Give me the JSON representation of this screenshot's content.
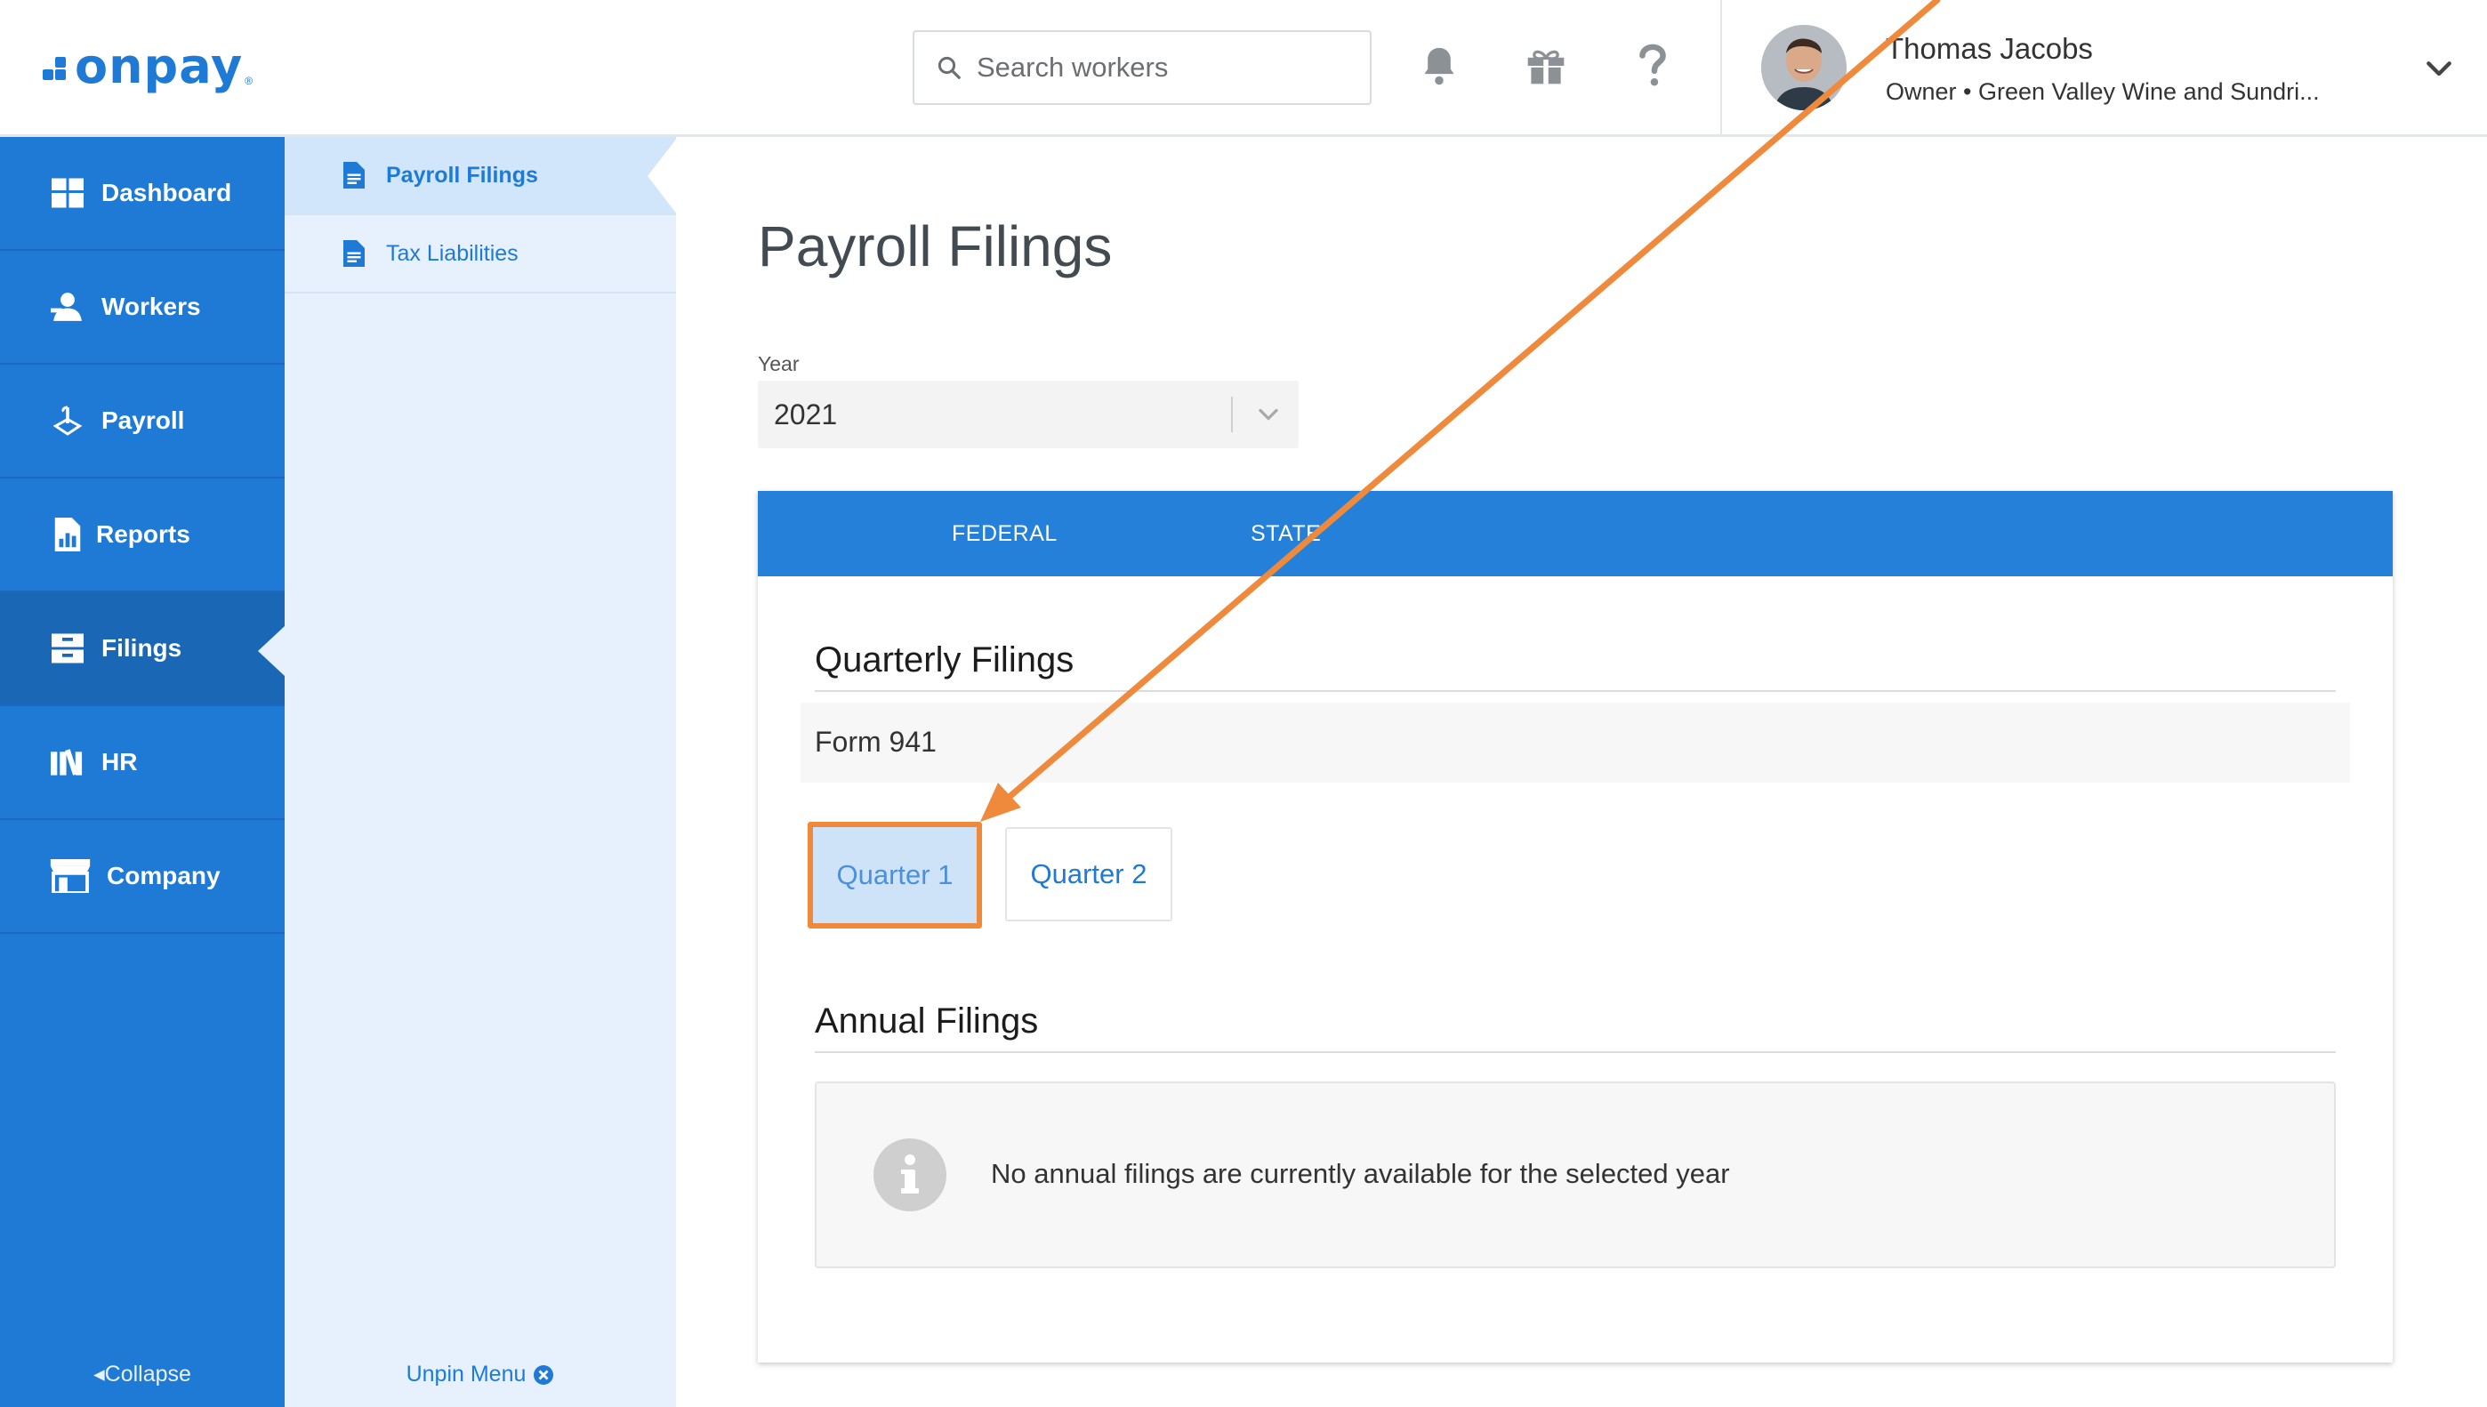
{
  "brand": {
    "logo_text": "onpay",
    "logo_mark": "®",
    "accent": "#1f7ad6"
  },
  "header": {
    "search": {
      "placeholder": "Search workers"
    },
    "icons": [
      "bell-icon",
      "gift-icon",
      "help-icon"
    ],
    "user": {
      "name": "Thomas Jacobs",
      "subtitle": "Owner • Green Valley Wine and Sundri..."
    }
  },
  "nav": {
    "items": [
      {
        "label": "Dashboard",
        "icon": "dashboard-icon"
      },
      {
        "label": "Workers",
        "icon": "workers-icon"
      },
      {
        "label": "Payroll",
        "icon": "payroll-icon"
      },
      {
        "label": "Reports",
        "icon": "reports-icon"
      },
      {
        "label": "Filings",
        "icon": "filings-icon",
        "active": true
      },
      {
        "label": "HR",
        "icon": "hr-icon"
      },
      {
        "label": "Company",
        "icon": "company-icon"
      }
    ],
    "collapse_label": "Collapse"
  },
  "subnav": {
    "items": [
      {
        "label": "Payroll Filings",
        "active": true
      },
      {
        "label": "Tax Liabilities"
      }
    ],
    "unpin_label": "Unpin Menu"
  },
  "main": {
    "title": "Payroll Filings",
    "year": {
      "label": "Year",
      "value": "2021"
    },
    "tabs": [
      {
        "label": "FEDERAL",
        "active": true
      },
      {
        "label": "STATE"
      }
    ],
    "quarterly": {
      "title": "Quarterly Filings",
      "form": "Form 941",
      "quarters": [
        {
          "label": "Quarter 1",
          "selected": true
        },
        {
          "label": "Quarter 2"
        }
      ]
    },
    "annual": {
      "title": "Annual Filings",
      "empty_message": "No annual filings are currently available for the selected year"
    }
  },
  "annotation": {
    "color": "#ef8a3d"
  }
}
